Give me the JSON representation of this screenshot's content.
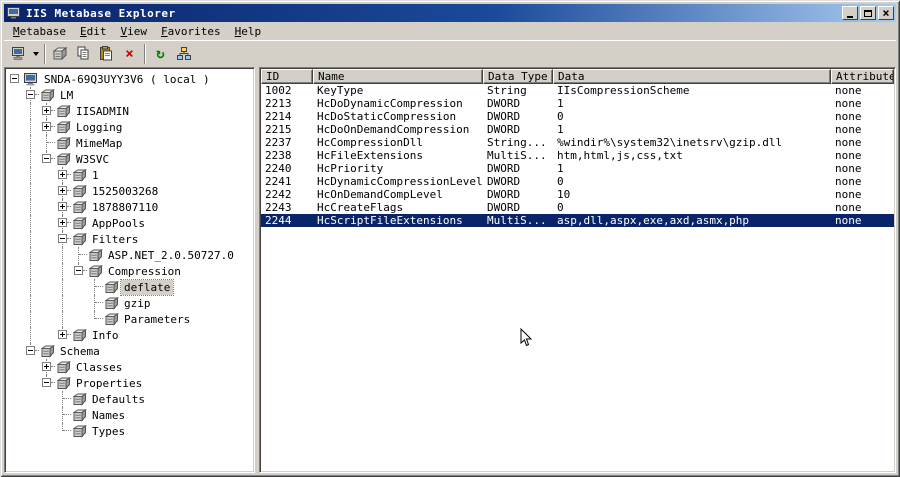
{
  "window": {
    "title": "IIS Metabase Explorer",
    "controls": [
      {
        "name": "minimize"
      },
      {
        "name": "maximize"
      },
      {
        "name": "close"
      }
    ]
  },
  "colors": {
    "selection": "#0a246a",
    "chrome": "#d4d0c8",
    "title_gradient_start": "#0a246a",
    "title_gradient_end": "#a6caf0",
    "inactive_selection": "#d4d0c8"
  },
  "menu": {
    "items": [
      {
        "label": "Metabase",
        "hotkey": 0
      },
      {
        "label": "Edit",
        "hotkey": 0
      },
      {
        "label": "View",
        "hotkey": 0
      },
      {
        "label": "Favorites",
        "hotkey": 0
      },
      {
        "label": "Help",
        "hotkey": 0
      }
    ]
  },
  "toolbar": {
    "buttons": [
      {
        "type": "button",
        "icon": "connect",
        "dropdown": true
      },
      {
        "type": "separator"
      },
      {
        "type": "button",
        "icon": "new-key"
      },
      {
        "type": "button",
        "icon": "copy"
      },
      {
        "type": "button",
        "icon": "paste"
      },
      {
        "type": "button",
        "icon": "delete"
      },
      {
        "type": "separator"
      },
      {
        "type": "button",
        "icon": "refresh"
      },
      {
        "type": "button",
        "icon": "permissions"
      }
    ]
  },
  "tree": {
    "nodes": [
      {
        "g": "",
        "j": "root",
        "e": "-",
        "icon": "computer",
        "label": "SNDA-69Q3UYY3V6 ( local )"
      },
      {
        "g": "b",
        "j": "tee",
        "e": "-",
        "icon": "key",
        "label": "LM"
      },
      {
        "g": "bl",
        "j": "tee",
        "e": "+",
        "icon": "key",
        "label": "IISADMIN"
      },
      {
        "g": "bl",
        "j": "tee",
        "e": "+",
        "icon": "key",
        "label": "Logging"
      },
      {
        "g": "bl",
        "j": "tee",
        "e": "",
        "icon": "key",
        "label": "MimeMap"
      },
      {
        "g": "bl",
        "j": "elbow",
        "e": "-",
        "icon": "key",
        "label": "W3SVC"
      },
      {
        "g": "blb",
        "j": "tee",
        "e": "+",
        "icon": "key",
        "label": "1"
      },
      {
        "g": "blb",
        "j": "tee",
        "e": "+",
        "icon": "key",
        "label": "1525003268"
      },
      {
        "g": "blb",
        "j": "tee",
        "e": "+",
        "icon": "key",
        "label": "1878807110"
      },
      {
        "g": "blb",
        "j": "tee",
        "e": "+",
        "icon": "key",
        "label": "AppPools"
      },
      {
        "g": "blb",
        "j": "tee",
        "e": "-",
        "icon": "key",
        "label": "Filters"
      },
      {
        "g": "blbl",
        "j": "tee",
        "e": "",
        "icon": "key",
        "label": "ASP.NET_2.0.50727.0"
      },
      {
        "g": "blbl",
        "j": "elbow",
        "e": "-",
        "icon": "key",
        "label": "Compression"
      },
      {
        "g": "blblb",
        "j": "tee",
        "e": "",
        "icon": "key",
        "label": "deflate",
        "selected": true
      },
      {
        "g": "blblb",
        "j": "tee",
        "e": "",
        "icon": "key",
        "label": "gzip"
      },
      {
        "g": "blblb",
        "j": "elbow",
        "e": "",
        "icon": "key",
        "label": "Parameters"
      },
      {
        "g": "blb",
        "j": "elbow",
        "e": "+",
        "icon": "key",
        "label": "Info"
      },
      {
        "g": "b",
        "j": "elbow",
        "e": "-",
        "icon": "key",
        "label": "Schema"
      },
      {
        "g": "bb",
        "j": "tee",
        "e": "+",
        "icon": "key",
        "label": "Classes"
      },
      {
        "g": "bb",
        "j": "elbow",
        "e": "-",
        "icon": "key",
        "label": "Properties"
      },
      {
        "g": "bbb",
        "j": "tee",
        "e": "",
        "icon": "key",
        "label": "Defaults"
      },
      {
        "g": "bbb",
        "j": "tee",
        "e": "",
        "icon": "key",
        "label": "Names"
      },
      {
        "g": "bbb",
        "j": "elbow",
        "e": "",
        "icon": "key",
        "label": "Types"
      }
    ]
  },
  "table": {
    "columns": [
      {
        "label": "ID"
      },
      {
        "label": "Name"
      },
      {
        "label": "Data Type"
      },
      {
        "label": "Data"
      },
      {
        "label": "Attributes"
      }
    ],
    "rows": [
      {
        "id": "1002",
        "name": "KeyType",
        "type": "String",
        "data": "IIsCompressionScheme",
        "attributes": "none"
      },
      {
        "id": "2213",
        "name": "HcDoDynamicCompression",
        "type": "DWORD",
        "data": "1",
        "attributes": "none"
      },
      {
        "id": "2214",
        "name": "HcDoStaticCompression",
        "type": "DWORD",
        "data": "0",
        "attributes": "none"
      },
      {
        "id": "2215",
        "name": "HcDoOnDemandCompression",
        "type": "DWORD",
        "data": "1",
        "attributes": "none"
      },
      {
        "id": "2237",
        "name": "HcCompressionDll",
        "type": "String...",
        "data": "%windir%\\system32\\inetsrv\\gzip.dll",
        "attributes": "none"
      },
      {
        "id": "2238",
        "name": "HcFileExtensions",
        "type": "MultiS...",
        "data": "htm,html,js,css,txt",
        "attributes": "none"
      },
      {
        "id": "2240",
        "name": "HcPriority",
        "type": "DWORD",
        "data": "1",
        "attributes": "none"
      },
      {
        "id": "2241",
        "name": "HcDynamicCompressionLevel",
        "type": "DWORD",
        "data": "0",
        "attributes": "none"
      },
      {
        "id": "2242",
        "name": "HcOnDemandCompLevel",
        "type": "DWORD",
        "data": "10",
        "attributes": "none"
      },
      {
        "id": "2243",
        "name": "HcCreateFlags",
        "type": "DWORD",
        "data": "0",
        "attributes": "none"
      },
      {
        "id": "2244",
        "name": "HcScriptFileExtensions",
        "type": "MultiS...",
        "data": "asp,dll,aspx,exe,axd,asmx,php",
        "attributes": "none",
        "selected": true
      }
    ]
  }
}
